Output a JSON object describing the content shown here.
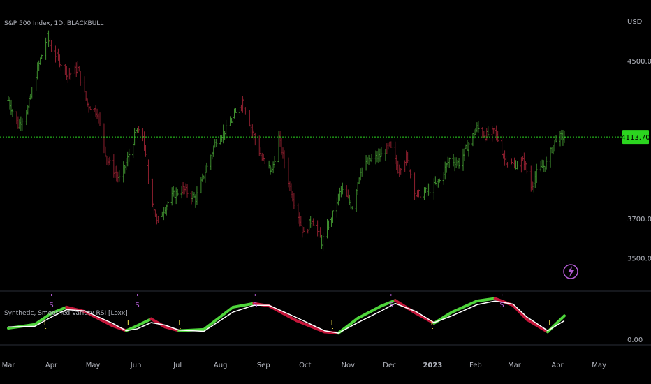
{
  "header": {
    "symbol_title": "S&P 500 Index, 1D, BLACKBULL",
    "currency": "USD"
  },
  "indicator": {
    "title": "Synthetic, Smoothed Variety RSI [Loxx]"
  },
  "colors": {
    "background": "#000000",
    "bull": "#3f8f2f",
    "bear": "#8c1f2e",
    "price_line": "#2bd51f",
    "price_tag_bg": "#2bd51f",
    "rsi_up": "#4ed43b",
    "rsi_down": "#c4163a",
    "signal": "#ffffff",
    "long_marker": "#f0e04a",
    "short_marker": "#b05bd0",
    "separator": "#2a2e39",
    "axis_text": "#b2b5be"
  },
  "icons": {
    "replay": "lightning-icon"
  },
  "chart_data": [
    {
      "type": "ohlc",
      "title": "S&P 500 Index, 1D, BLACKBULL",
      "xlabel": "",
      "ylabel": "USD",
      "ylim": [
        3400,
        4700
      ],
      "x_ticks": [
        "Mar",
        "Apr",
        "May",
        "Jun",
        "Jul",
        "Aug",
        "Sep",
        "Oct",
        "Nov",
        "Dec",
        "2023",
        "Feb",
        "Mar",
        "Apr",
        "May"
      ],
      "y_ticks": [
        "4500.00",
        "3700.00",
        "3500.00"
      ],
      "last_price": 4113.7,
      "last_price_label": "4113.70",
      "close_path": [
        [
          "2022-03-01",
          4300
        ],
        [
          "2022-03-08",
          4170
        ],
        [
          "2022-03-15",
          4260
        ],
        [
          "2022-03-22",
          4460
        ],
        [
          "2022-03-29",
          4620
        ],
        [
          "2022-04-01",
          4560
        ],
        [
          "2022-04-06",
          4510
        ],
        [
          "2022-04-13",
          4430
        ],
        [
          "2022-04-20",
          4460
        ],
        [
          "2022-04-27",
          4280
        ],
        [
          "2022-05-04",
          4240
        ],
        [
          "2022-05-11",
          4000
        ],
        [
          "2022-05-20",
          3900
        ],
        [
          "2022-05-25",
          3980
        ],
        [
          "2022-06-01",
          4140
        ],
        [
          "2022-06-06",
          4120
        ],
        [
          "2022-06-10",
          3900
        ],
        [
          "2022-06-16",
          3680
        ],
        [
          "2022-06-22",
          3760
        ],
        [
          "2022-06-28",
          3820
        ],
        [
          "2022-07-05",
          3850
        ],
        [
          "2022-07-14",
          3800
        ],
        [
          "2022-07-22",
          3960
        ],
        [
          "2022-07-29",
          4100
        ],
        [
          "2022-08-05",
          4150
        ],
        [
          "2022-08-12",
          4230
        ],
        [
          "2022-08-17",
          4300
        ],
        [
          "2022-08-24",
          4140
        ],
        [
          "2022-08-31",
          4000
        ],
        [
          "2022-09-07",
          3940
        ],
        [
          "2022-09-12",
          4110
        ],
        [
          "2022-09-20",
          3860
        ],
        [
          "2022-09-30",
          3620
        ],
        [
          "2022-10-06",
          3700
        ],
        [
          "2022-10-13",
          3580
        ],
        [
          "2022-10-20",
          3700
        ],
        [
          "2022-10-27",
          3850
        ],
        [
          "2022-11-04",
          3760
        ],
        [
          "2022-11-10",
          3950
        ],
        [
          "2022-11-18",
          4000
        ],
        [
          "2022-11-25",
          4020
        ],
        [
          "2022-12-01",
          4070
        ],
        [
          "2022-12-07",
          3950
        ],
        [
          "2022-12-13",
          4010
        ],
        [
          "2022-12-20",
          3820
        ],
        [
          "2022-12-29",
          3840
        ],
        [
          "2023-01-06",
          3890
        ],
        [
          "2023-01-13",
          4000
        ],
        [
          "2023-01-20",
          3980
        ],
        [
          "2023-01-27",
          4080
        ],
        [
          "2023-02-02",
          4160
        ],
        [
          "2023-02-08",
          4120
        ],
        [
          "2023-02-15",
          4140
        ],
        [
          "2023-02-22",
          4000
        ],
        [
          "2023-03-01",
          3970
        ],
        [
          "2023-03-08",
          3990
        ],
        [
          "2023-03-13",
          3860
        ],
        [
          "2023-03-17",
          3930
        ],
        [
          "2023-03-24",
          3980
        ],
        [
          "2023-03-31",
          4110
        ],
        [
          "2023-04-06",
          4113.7
        ]
      ]
    },
    {
      "type": "line",
      "title": "Synthetic, Smoothed Variety RSI [Loxx]",
      "ylim": [
        0,
        100
      ],
      "y_ticks": [
        "0.00"
      ],
      "series": [
        {
          "role": "rsi",
          "x": [
            "2022-03-01",
            "2022-03-20",
            "2022-04-01",
            "2022-04-12",
            "2022-04-25",
            "2022-05-15",
            "2022-05-25",
            "2022-06-02",
            "2022-06-12",
            "2022-06-22",
            "2022-07-02",
            "2022-07-20",
            "2022-08-10",
            "2022-08-25",
            "2022-09-05",
            "2022-09-25",
            "2022-10-15",
            "2022-10-25",
            "2022-11-08",
            "2022-11-25",
            "2022-12-05",
            "2022-12-20",
            "2023-01-02",
            "2023-01-15",
            "2023-02-02",
            "2023-02-15",
            "2023-02-28",
            "2023-03-10",
            "2023-03-25",
            "2023-04-06"
          ],
          "values": [
            18,
            24,
            42,
            52,
            45,
            22,
            14,
            22,
            33,
            20,
            14,
            16,
            52,
            58,
            54,
            30,
            12,
            10,
            34,
            54,
            63,
            42,
            26,
            44,
            62,
            66,
            55,
            32,
            12,
            38
          ]
        },
        {
          "role": "signal",
          "x": [
            "2022-03-01",
            "2022-03-20",
            "2022-04-01",
            "2022-04-12",
            "2022-04-25",
            "2022-05-15",
            "2022-05-25",
            "2022-06-02",
            "2022-06-12",
            "2022-06-22",
            "2022-07-02",
            "2022-07-20",
            "2022-08-10",
            "2022-08-25",
            "2022-09-05",
            "2022-09-25",
            "2022-10-15",
            "2022-10-25",
            "2022-11-08",
            "2022-11-25",
            "2022-12-05",
            "2022-12-20",
            "2023-01-02",
            "2023-01-15",
            "2023-02-02",
            "2023-02-15",
            "2023-02-28",
            "2023-03-10",
            "2023-03-25",
            "2023-04-06"
          ],
          "values": [
            20,
            21,
            36,
            48,
            46,
            26,
            14,
            17,
            27,
            23,
            15,
            13,
            44,
            55,
            55,
            35,
            14,
            10,
            27,
            46,
            58,
            45,
            27,
            38,
            56,
            62,
            57,
            36,
            14,
            30
          ]
        }
      ],
      "markers": [
        {
          "label": "L",
          "date": "2022-03-28"
        },
        {
          "label": "S",
          "date": "2022-04-01"
        },
        {
          "label": "L",
          "date": "2022-05-27"
        },
        {
          "label": "S",
          "date": "2022-06-02"
        },
        {
          "label": "L",
          "date": "2022-07-03"
        },
        {
          "label": "S",
          "date": "2022-08-26"
        },
        {
          "label": "L",
          "date": "2022-10-21"
        },
        {
          "label": "S",
          "date": "2022-12-02"
        },
        {
          "label": "L",
          "date": "2023-01-01"
        },
        {
          "label": "S",
          "date": "2023-02-20"
        },
        {
          "label": "L",
          "date": "2023-03-27"
        }
      ]
    }
  ]
}
